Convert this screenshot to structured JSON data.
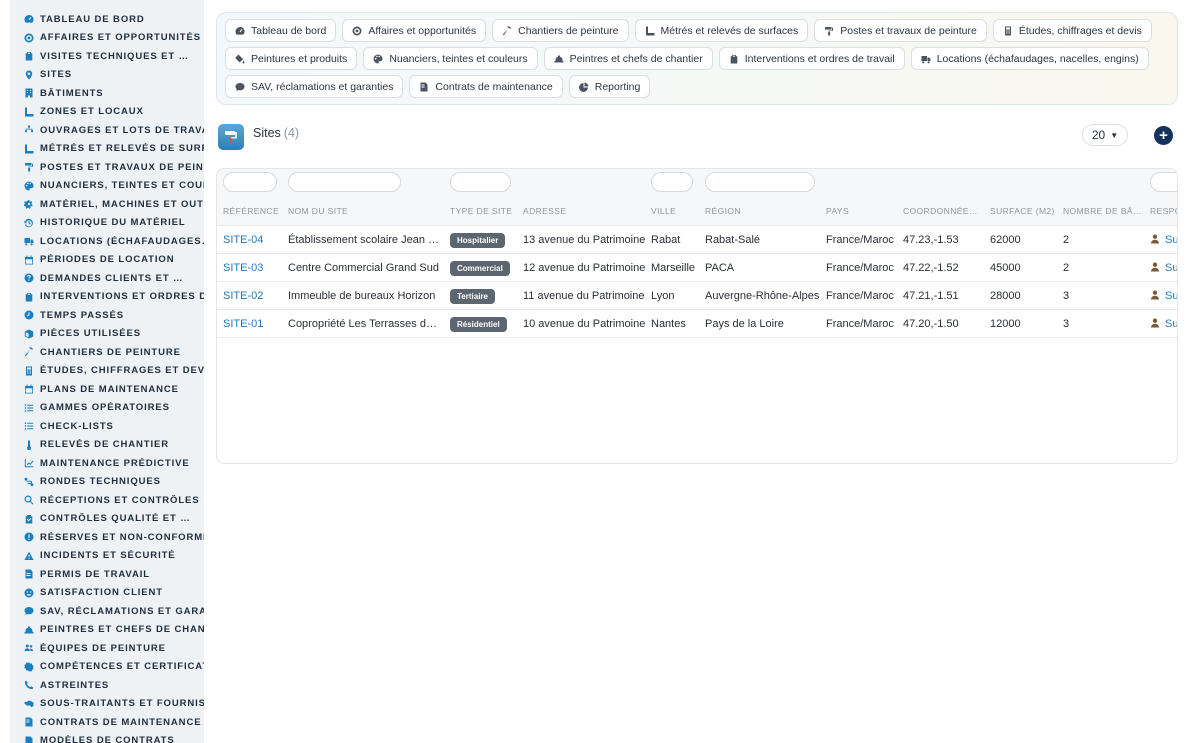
{
  "sidebar": {
    "items": [
      {
        "label": "Tableau de bord",
        "icon": "dashboard-icon"
      },
      {
        "label": "Affaires et opportunités",
        "icon": "target-icon"
      },
      {
        "label": "Visites techniques et …",
        "icon": "clipboard-icon"
      },
      {
        "label": "Sites",
        "icon": "map-pin-icon"
      },
      {
        "label": "Bâtiments",
        "icon": "building-icon"
      },
      {
        "label": "Zones et locaux",
        "icon": "ruler-icon"
      },
      {
        "label": "Ouvrages et lots de travaux",
        "icon": "sitemap-icon"
      },
      {
        "label": "Métrés et relevés de surfaces",
        "icon": "ruler-icon"
      },
      {
        "label": "Postes et travaux de peinture",
        "icon": "paint-roller-icon"
      },
      {
        "label": "Nuanciers, teintes et couleurs",
        "icon": "palette-icon"
      },
      {
        "label": "Matériel, machines et outillage",
        "icon": "cogs-icon"
      },
      {
        "label": "Historique du matériel",
        "icon": "history-icon"
      },
      {
        "label": "Locations (échafaudages…)",
        "icon": "truck-icon"
      },
      {
        "label": "Périodes de location",
        "icon": "calendar-icon"
      },
      {
        "label": "Demandes clients et …",
        "icon": "question-icon"
      },
      {
        "label": "Interventions et ordres de travail",
        "icon": "clipboard-icon"
      },
      {
        "label": "Temps passés",
        "icon": "clock-icon"
      },
      {
        "label": "Pièces utilisées",
        "icon": "box-icon"
      },
      {
        "label": "Chantiers de peinture",
        "icon": "hammer-icon"
      },
      {
        "label": "Études, chiffrages et devis",
        "icon": "calculator-icon"
      },
      {
        "label": "Plans de maintenance",
        "icon": "calendar-icon"
      },
      {
        "label": "Gammes opératoires",
        "icon": "list-icon"
      },
      {
        "label": "Check-lists",
        "icon": "list-icon"
      },
      {
        "label": "Relevés de chantier",
        "icon": "thermometer-icon"
      },
      {
        "label": "Maintenance prédictive",
        "icon": "chart-line-icon"
      },
      {
        "label": "Rondes techniques",
        "icon": "route-icon"
      },
      {
        "label": "Réceptions et contrôles",
        "icon": "search-icon"
      },
      {
        "label": "Contrôles qualité et …",
        "icon": "clipboard-check-icon"
      },
      {
        "label": "Réserves et non-conformités",
        "icon": "exclamation-icon"
      },
      {
        "label": "Incidents et sécurité",
        "icon": "warning-icon"
      },
      {
        "label": "Permis de travail",
        "icon": "file-signature-icon"
      },
      {
        "label": "Satisfaction client",
        "icon": "smile-icon"
      },
      {
        "label": "SAV, réclamations et garanties",
        "icon": "comment-icon"
      },
      {
        "label": "Peintres et chefs de chantier",
        "icon": "hard-hat-icon"
      },
      {
        "label": "Équipes de peinture",
        "icon": "users-icon"
      },
      {
        "label": "Compétences et certifications",
        "icon": "certificate-icon"
      },
      {
        "label": "Astreintes",
        "icon": "phone-icon"
      },
      {
        "label": "Sous-traitants et fournisseurs",
        "icon": "handshake-icon"
      },
      {
        "label": "Contrats de maintenance",
        "icon": "file-contract-icon"
      },
      {
        "label": "Modèles de contrats",
        "icon": "file-icon"
      }
    ]
  },
  "nav": {
    "rows": [
      [
        {
          "label": "Tableau de bord",
          "icon": "dashboard-icon"
        },
        {
          "label": "Affaires et opportunités",
          "icon": "target-icon"
        },
        {
          "label": "Chantiers de peinture",
          "icon": "hammer-icon"
        },
        {
          "label": "Métrés et relevés de surfaces",
          "icon": "ruler-icon"
        },
        {
          "label": "Postes et travaux de peinture",
          "icon": "paint-roller-icon"
        },
        {
          "label": "Études, chiffrages et devis",
          "icon": "calculator-icon"
        }
      ],
      [
        {
          "label": "Peintures et produits",
          "icon": "fill-drip-icon"
        },
        {
          "label": "Nuanciers, teintes et couleurs",
          "icon": "palette-icon"
        },
        {
          "label": "Peintres et chefs de chantier",
          "icon": "hard-hat-icon"
        },
        {
          "label": "Interventions et ordres de travail",
          "icon": "clipboard-icon"
        },
        {
          "label": "Locations (échafaudages, nacelles, engins)",
          "icon": "truck-icon"
        }
      ],
      [
        {
          "label": "SAV, réclamations et garanties",
          "icon": "comment-icon"
        },
        {
          "label": "Contrats de maintenance",
          "icon": "file-contract-icon"
        },
        {
          "label": "Reporting",
          "icon": "chart-pie-icon"
        }
      ]
    ]
  },
  "section": {
    "title": "Sites",
    "count": "(4)",
    "page_size": "20",
    "add_icon": "plus-circle-icon",
    "app_icon": "paint-roller-app-icon"
  },
  "table": {
    "columns": [
      "Référence",
      "Nom du site",
      "Type de site",
      "Adresse",
      "Ville",
      "Région",
      "Pays",
      "Coordonnée…",
      "Surface (m2)",
      "Nombre de bâ…",
      "Respo"
    ],
    "rows": [
      {
        "ref": "SITE-04",
        "nom": "Établissement scolaire Jean J…",
        "type": "Hospitalier",
        "adresse": "13 avenue du Patrimoine",
        "ville": "Rabat",
        "region": "Rabat-Salé",
        "pays": "France/Maroc",
        "coord": "47.23,-1.53",
        "surface": "62000",
        "nb": "2",
        "resp": "Su"
      },
      {
        "ref": "SITE-03",
        "nom": "Centre Commercial Grand Sud",
        "type": "Commercial",
        "adresse": "12 avenue du Patrimoine",
        "ville": "Marseille",
        "region": "PACA",
        "pays": "France/Maroc",
        "coord": "47.22,-1.52",
        "surface": "45000",
        "nb": "2",
        "resp": "Su"
      },
      {
        "ref": "SITE-02",
        "nom": "Immeuble de bureaux Horizon",
        "type": "Tertiaire",
        "adresse": "11 avenue du Patrimoine",
        "ville": "Lyon",
        "region": "Auvergne-Rhône-Alpes",
        "pays": "France/Maroc",
        "coord": "47.21,-1.51",
        "surface": "28000",
        "nb": "3",
        "resp": "Su"
      },
      {
        "ref": "SITE-01",
        "nom": "Copropriété Les Terrasses du…",
        "type": "Résidentiel",
        "adresse": "10 avenue du Patrimoine",
        "ville": "Nantes",
        "region": "Pays de la Loire",
        "pays": "France/Maroc",
        "coord": "47.20,-1.50",
        "surface": "12000",
        "nb": "3",
        "resp": "Su"
      }
    ]
  },
  "colors": {
    "accent": "#1f7ac2",
    "sidebar_bg": "#eef2f5",
    "badge_bg": "#5c6670",
    "add_button": "#16325c"
  }
}
